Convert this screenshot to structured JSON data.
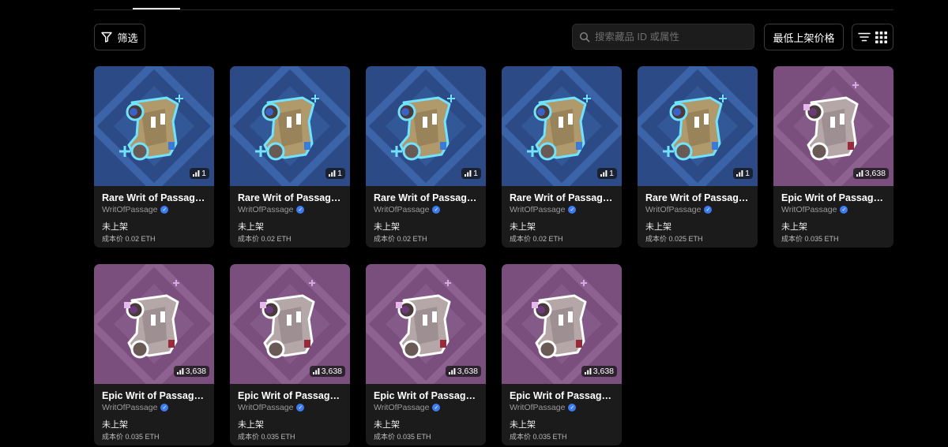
{
  "toolbar": {
    "filter_label": "筛选",
    "search_placeholder": "搜索藏品 ID 或属性",
    "sort_label": "最低上架价格"
  },
  "items": [
    {
      "name": "Rare Writ of Passage ...",
      "collection": "WritOfPassage",
      "status": "未上架",
      "cost": "成本价 0.02 ETH",
      "count": "1",
      "rarity": "rare"
    },
    {
      "name": "Rare Writ of Passage ...",
      "collection": "WritOfPassage",
      "status": "未上架",
      "cost": "成本价 0.02 ETH",
      "count": "1",
      "rarity": "rare"
    },
    {
      "name": "Rare Writ of Passage ...",
      "collection": "WritOfPassage",
      "status": "未上架",
      "cost": "成本价 0.02 ETH",
      "count": "1",
      "rarity": "rare"
    },
    {
      "name": "Rare Writ of Passage ...",
      "collection": "WritOfPassage",
      "status": "未上架",
      "cost": "成本价 0.02 ETH",
      "count": "1",
      "rarity": "rare"
    },
    {
      "name": "Rare Writ of Passage ...",
      "collection": "WritOfPassage",
      "status": "未上架",
      "cost": "成本价 0.025 ETH",
      "count": "1",
      "rarity": "rare"
    },
    {
      "name": "Epic Writ of Passage #...",
      "collection": "WritOfPassage",
      "status": "未上架",
      "cost": "成本价 0.035 ETH",
      "count": "3,638",
      "rarity": "epic"
    },
    {
      "name": "Epic Writ of Passage #...",
      "collection": "WritOfPassage",
      "status": "未上架",
      "cost": "成本价 0.035 ETH",
      "count": "3,638",
      "rarity": "epic"
    },
    {
      "name": "Epic Writ of Passage #...",
      "collection": "WritOfPassage",
      "status": "未上架",
      "cost": "成本价 0.035 ETH",
      "count": "3,638",
      "rarity": "epic"
    },
    {
      "name": "Epic Writ of Passage #...",
      "collection": "WritOfPassage",
      "status": "未上架",
      "cost": "成本价 0.035 ETH",
      "count": "3,638",
      "rarity": "epic"
    },
    {
      "name": "Epic Writ of Passage #...",
      "collection": "WritOfPassage",
      "status": "未上架",
      "cost": "成本价 0.035 ETH",
      "count": "3,638",
      "rarity": "epic"
    }
  ],
  "colors": {
    "rare_bg": "#2c4b86",
    "epic_bg": "#7a4f7e",
    "card_bg": "#1b1b1b",
    "verified": "#3d7bf0"
  },
  "icons": {
    "filter": "funnel-icon",
    "search": "search-icon",
    "list_view": "list-view-icon",
    "grid_view": "grid-view-icon",
    "rarity": "signal-bars-icon",
    "verified": "verified-badge-icon"
  }
}
